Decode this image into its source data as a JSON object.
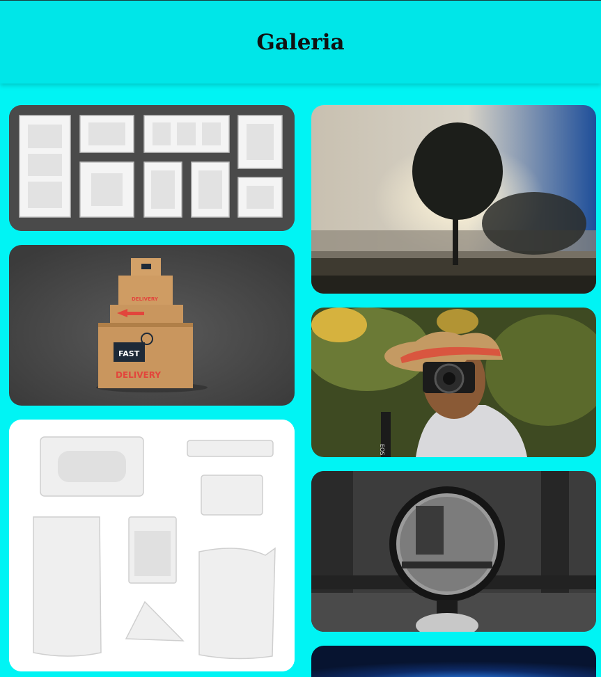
{
  "header": {
    "title": "Galeria"
  },
  "gallery": {
    "items": [
      {
        "name": "frames-mockup",
        "box_labels": []
      },
      {
        "name": "delivery-boxes",
        "box_labels": [
          "FAST",
          "DELIVERY"
        ]
      },
      {
        "name": "packaging-mockup"
      },
      {
        "name": "tree-sunrise"
      },
      {
        "name": "photographer",
        "camera_label": "EOS"
      },
      {
        "name": "magnifying-glass-forest"
      },
      {
        "name": "night-sky"
      }
    ]
  },
  "colors": {
    "background": "#00f4f4",
    "header": "#00e6e8"
  }
}
